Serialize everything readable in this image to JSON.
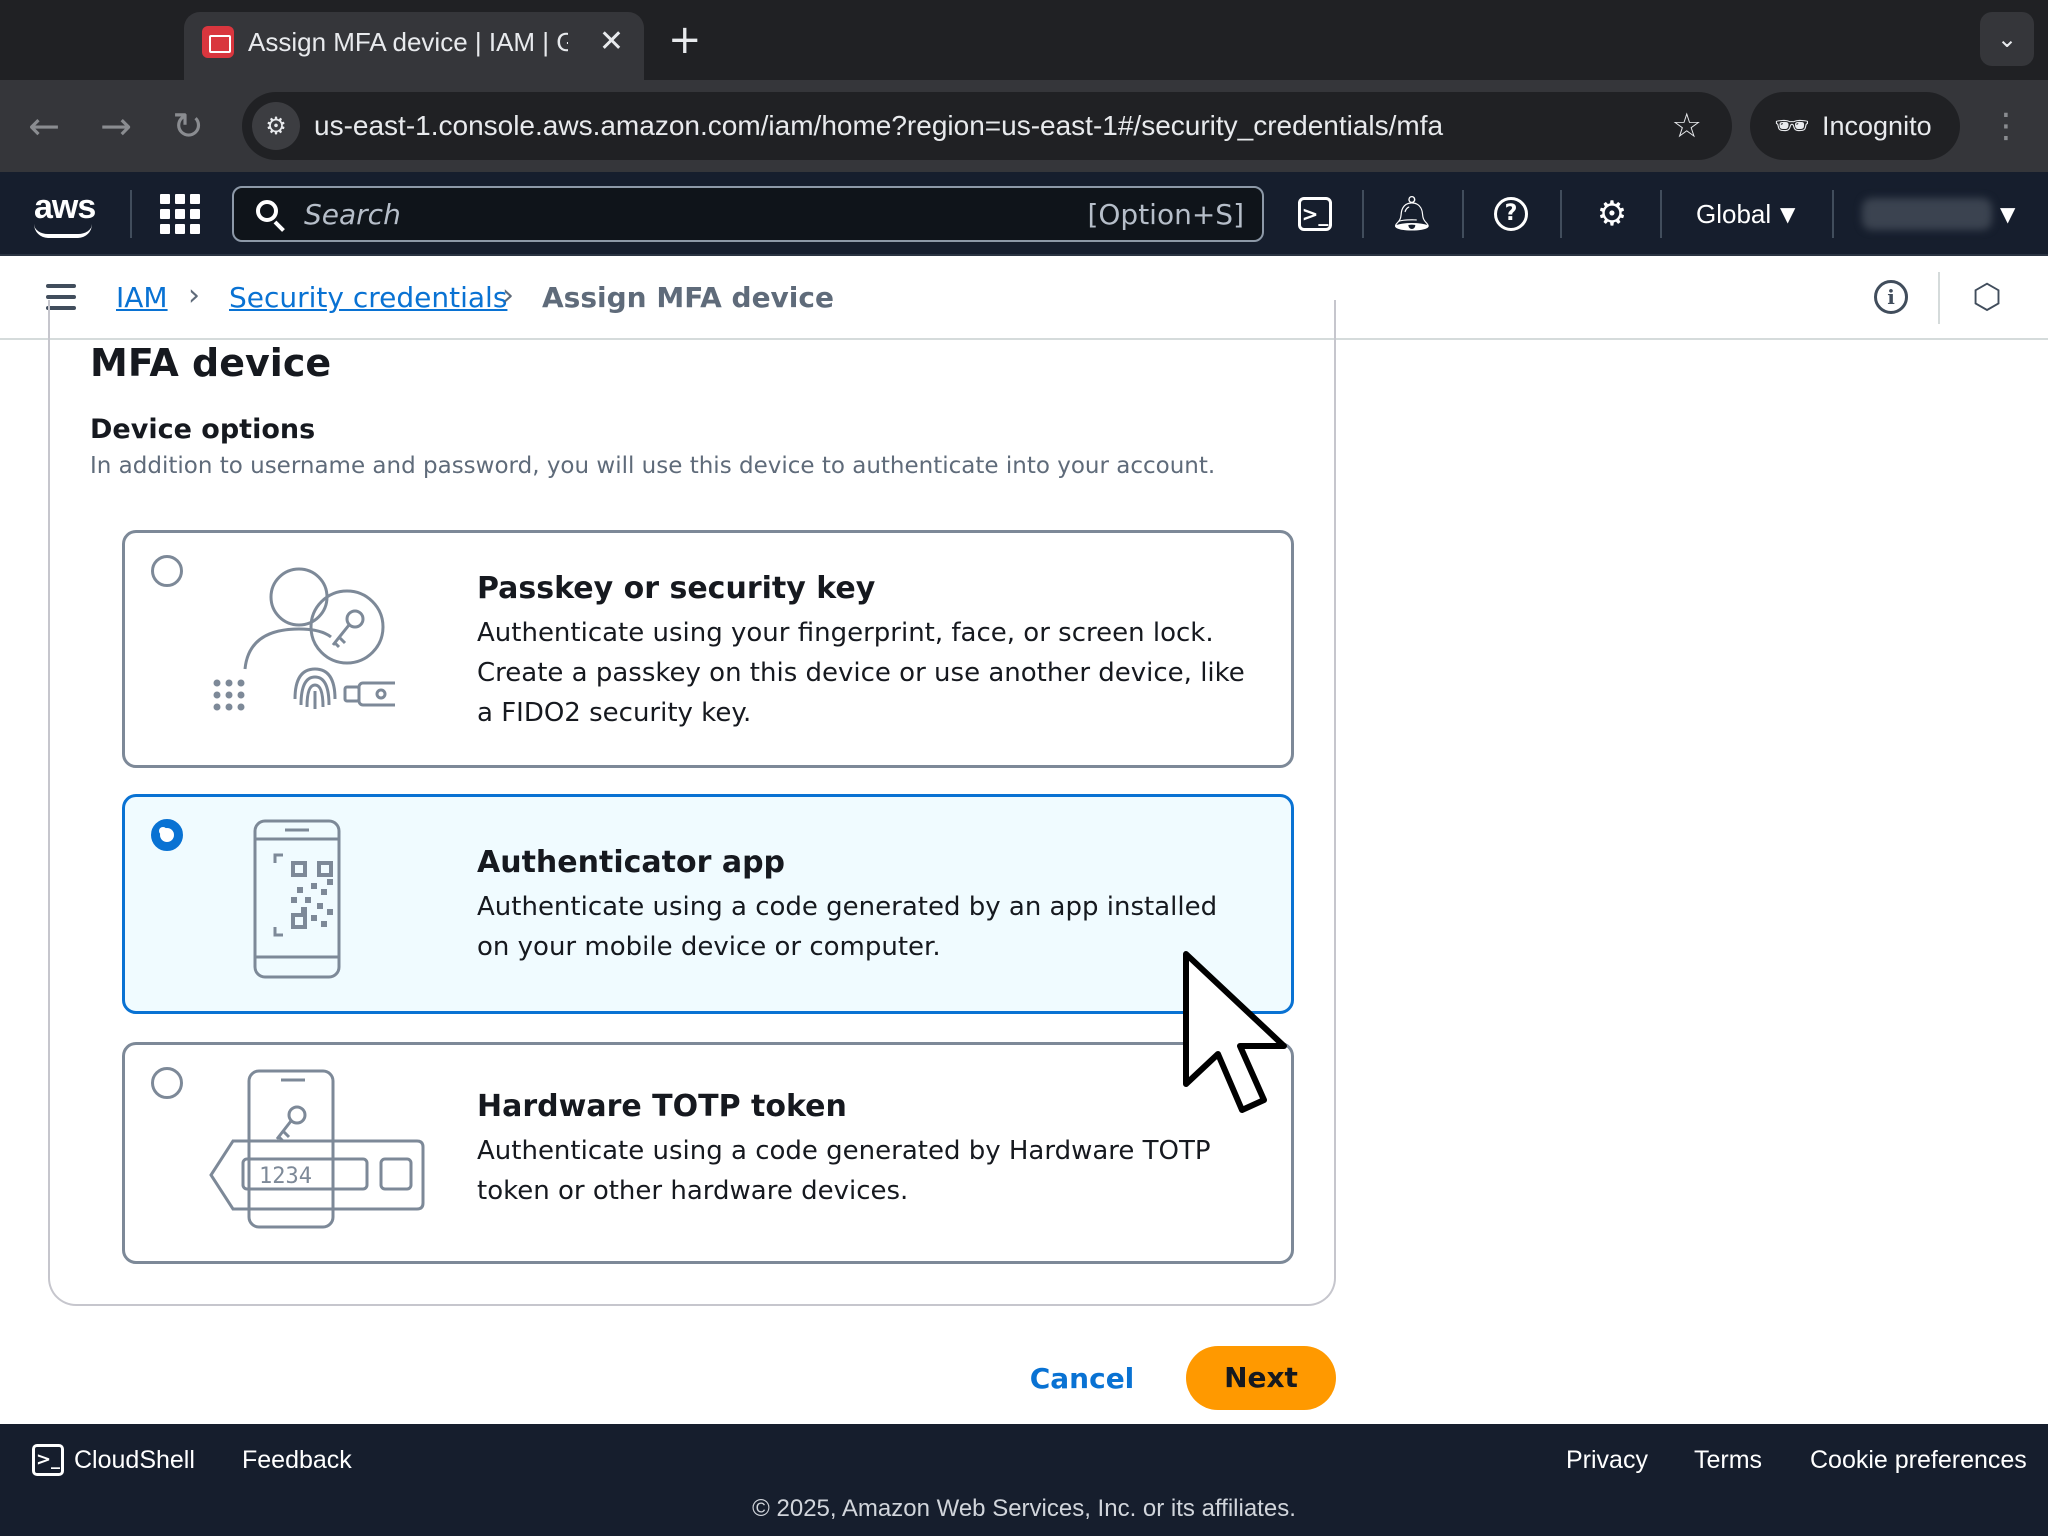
{
  "browser": {
    "tab_title": "Assign MFA device | IAM | Glo",
    "tab_close": "✕",
    "new_tab": "+",
    "url": "us-east-1.console.aws.amazon.com/iam/home?region=us-east-1#/security_credentials/mfa",
    "incognito_label": "Incognito"
  },
  "aws_nav": {
    "logo": "aws",
    "search_placeholder": "Search",
    "search_shortcut": "[Option+S]",
    "region": "Global"
  },
  "breadcrumb": {
    "items": [
      "IAM",
      "Security credentials",
      "Assign MFA device"
    ]
  },
  "panel": {
    "title": "MFA device",
    "section_label": "Device options",
    "section_desc": "In addition to username and password, you will use this device to authenticate into your account."
  },
  "options": [
    {
      "title": "Passkey or security key",
      "desc": "Authenticate using your fingerprint, face, or screen lock. Create a passkey on this device or use another device, like a FIDO2 security key.",
      "selected": false,
      "icon": "passkey-illustration"
    },
    {
      "title": "Authenticator app",
      "desc": "Authenticate using a code generated by an app installed on your mobile device or computer.",
      "selected": true,
      "icon": "authenticator-app-illustration"
    },
    {
      "title": "Hardware TOTP token",
      "desc": "Authenticate using a code generated by Hardware TOTP token or other hardware devices.",
      "selected": false,
      "icon": "hardware-token-illustration",
      "token_digits": "1234"
    }
  ],
  "actions": {
    "cancel": "Cancel",
    "next": "Next"
  },
  "footer": {
    "cloudshell": "CloudShell",
    "feedback": "Feedback",
    "privacy": "Privacy",
    "terms": "Terms",
    "cookie": "Cookie preferences",
    "copyright": "© 2025, Amazon Web Services, Inc. or its affiliates."
  },
  "colors": {
    "link": "#0972d3",
    "primary_button": "#ff9900",
    "selected_bg": "#f0fbff",
    "nav_bg": "#161e2d"
  }
}
